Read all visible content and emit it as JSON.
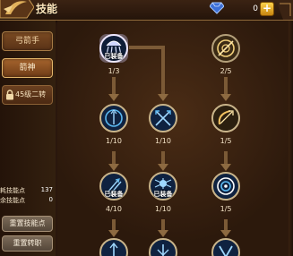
{
  "header": {
    "title": "技能",
    "currency_value": "0",
    "plus_label": "+"
  },
  "sidebar": {
    "tabs": [
      {
        "label": "弓箭手",
        "active": false
      },
      {
        "label": "箭神",
        "active": true
      }
    ],
    "locked_label": "45级二转",
    "points": [
      {
        "label": "耗技能点",
        "value": "137"
      },
      {
        "label": "余技能点",
        "value": "0"
      }
    ],
    "buttons": [
      "重置技能点",
      "重置转职"
    ]
  },
  "skills": [
    {
      "id": "rain-arrow",
      "icon": "arrow-rain-icon",
      "level": "1/3",
      "equipped": true,
      "highlight": true
    },
    {
      "id": "target-lock",
      "icon": "target-slash-icon",
      "level": "2/5",
      "equipped": false,
      "highlight": false
    },
    {
      "id": "clock-arrow",
      "icon": "clock-icon",
      "level": "1/10",
      "equipped": false,
      "highlight": false
    },
    {
      "id": "cross-arrows",
      "icon": "crossed-arrows-icon",
      "level": "1/10",
      "equipped": false,
      "highlight": false
    },
    {
      "id": "bow-shot",
      "icon": "bow-arrow-icon",
      "level": "1/5",
      "equipped": false,
      "highlight": false
    },
    {
      "id": "multi-shot",
      "icon": "multi-arrow-icon",
      "level": "4/10",
      "equipped": true,
      "highlight": false
    },
    {
      "id": "spider-trap",
      "icon": "spider-icon",
      "level": "1/10",
      "equipped": true,
      "highlight": false
    },
    {
      "id": "bullseye",
      "icon": "bullseye-icon",
      "level": "1/5",
      "equipped": false,
      "highlight": false
    },
    {
      "id": "partial-1",
      "icon": "arrow-up-icon",
      "level": "",
      "equipped": false,
      "highlight": false
    },
    {
      "id": "partial-2",
      "icon": "arrow-down-icon",
      "level": "",
      "equipped": false,
      "highlight": false
    },
    {
      "id": "partial-3",
      "icon": "chevron-down-icon",
      "level": "",
      "equipped": false,
      "highlight": false
    }
  ],
  "equipped_label": "已装备",
  "colors": {
    "node_ring": "#c9b48a",
    "node_fill": "#12233f",
    "highlight_ring": "#e9e2ff",
    "arrow_blue": "#5bb8f0"
  }
}
